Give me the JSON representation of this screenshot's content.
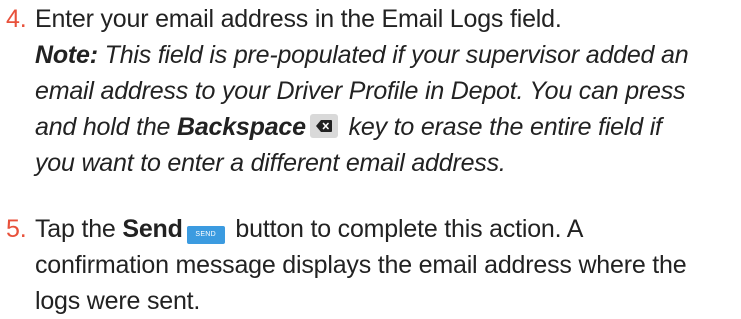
{
  "steps": [
    {
      "number": "4.",
      "text": "Enter your email address in the Email Logs field.",
      "note_label": "Note:",
      "note_line1": "This field is pre-populated if your supervisor added an",
      "note_line2": "email address to your Driver Profile in Depot. You can press",
      "note_line3_pre": "and hold the ",
      "note_line3_key": "Backspace",
      "note_line3_post": " key to erase the entire field if",
      "note_line4": "you want to enter a different email address.",
      "key_icon": "backspace-icon"
    },
    {
      "number": "5.",
      "line1_pre": "Tap the ",
      "line1_bold": "Send",
      "send_key_label": "SEND",
      "line1_post": " button to complete this action. A",
      "line2": "confirmation message displays the email address where the",
      "line3": "logs were sent."
    }
  ],
  "colors": {
    "step_number": "#e8513b",
    "send_button": "#3b9be0",
    "backspace_key": "#d9d9d9"
  }
}
